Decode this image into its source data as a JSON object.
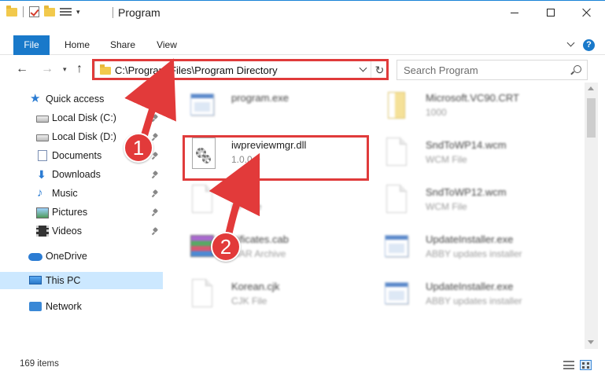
{
  "window": {
    "title": "Program"
  },
  "ribbon": {
    "tabs": [
      "File",
      "Home",
      "Share",
      "View"
    ]
  },
  "address": {
    "path": "C:\\Program Files\\Program Directory"
  },
  "search": {
    "placeholder": "Search Program"
  },
  "sidebar": {
    "items": [
      {
        "label": "Quick access",
        "icon": "star-icon",
        "pinned": false
      },
      {
        "label": "Local Disk (C:)",
        "icon": "disk-icon",
        "pinned": true
      },
      {
        "label": "Local Disk (D:)",
        "icon": "disk-icon",
        "pinned": true
      },
      {
        "label": "Documents",
        "icon": "documents-icon",
        "pinned": true
      },
      {
        "label": "Downloads",
        "icon": "downloads-icon",
        "pinned": true
      },
      {
        "label": "Music",
        "icon": "music-icon",
        "pinned": true
      },
      {
        "label": "Pictures",
        "icon": "pictures-icon",
        "pinned": true
      },
      {
        "label": "Videos",
        "icon": "videos-icon",
        "pinned": true
      },
      {
        "label": "OneDrive",
        "icon": "onedrive-icon",
        "pinned": false
      },
      {
        "label": "This PC",
        "icon": "this-pc-icon",
        "pinned": false,
        "selected": true
      },
      {
        "label": "Network",
        "icon": "network-icon",
        "pinned": false
      }
    ]
  },
  "files": [
    {
      "name": "program.exe",
      "type": "",
      "icon": "exe-icon",
      "blurred": true
    },
    {
      "name": "Microsoft.VC90.CRT",
      "type": "1000",
      "icon": "folder-doc-icon",
      "blurred": true
    },
    {
      "name": "iwpreviewmgr.dll",
      "type": "1.0.0.0",
      "icon": "dll-gear-icon",
      "blurred": false
    },
    {
      "name": "SndToWP14.wcm",
      "type": "WCM File",
      "icon": "document-icon",
      "blurred": true
    },
    {
      "name": "g",
      "type": "CF File",
      "icon": "document-icon",
      "blurred": true
    },
    {
      "name": "SndToWP12.wcm",
      "type": "WCM File",
      "icon": "document-icon",
      "blurred": true
    },
    {
      "name": "rtificates.cab",
      "type": "MAR Archive",
      "icon": "cab-icon",
      "blurred": true
    },
    {
      "name": "UpdateInstaller.exe",
      "type": "ABBY updates installer",
      "icon": "exe-icon",
      "blurred": true
    },
    {
      "name": "Korean.cjk",
      "type": "CJK File",
      "icon": "document-icon",
      "blurred": true
    },
    {
      "name": "UpdateInstaller.exe",
      "type": "ABBY updates installer",
      "icon": "exe-icon",
      "blurred": true
    }
  ],
  "callouts": [
    "1",
    "2"
  ],
  "status": {
    "item_count": "169 items"
  },
  "colors": {
    "accent": "#1979ca",
    "highlight": "#e03b3b",
    "selection": "#cce8ff"
  }
}
